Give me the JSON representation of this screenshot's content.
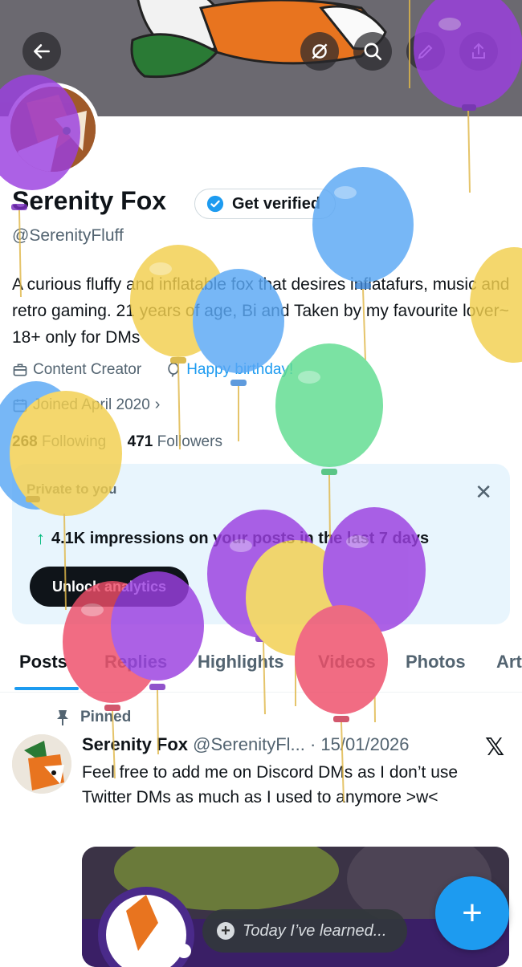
{
  "profile": {
    "name": "Serenity Fox",
    "handle": "@SerenityFluff",
    "verify_label": "Get verified",
    "bio": "A curious fluffy and inflatable fox that desires inflatafurs, music and retro gaming. 21 years of age, Bi and Taken by my favourite lover~ 18+ only for DMs",
    "category": "Content Creator",
    "birthday": "Happy birthday!",
    "joined": "Joined April 2020",
    "following_count": "268",
    "following_label": "Following",
    "followers_count": "471",
    "followers_label": "Followers"
  },
  "header": {
    "back_icon": "arrow-left-icon",
    "icons": [
      "sync-off-icon",
      "search-icon",
      "edit-icon",
      "share-icon"
    ]
  },
  "analytics": {
    "private_label": "Private to you",
    "impressions_text": "4.1K impressions on your posts in the last 7 days",
    "unlock_label": "Unlock analytics"
  },
  "tabs": [
    "Posts",
    "Replies",
    "Highlights",
    "Videos",
    "Photos",
    "Art"
  ],
  "post": {
    "pinned_label": "Pinned",
    "author": "Serenity Fox",
    "handle_date": "@SerenityFl... · 15/01/2026",
    "text": "Feel free to add me on Discord DMs as I don’t use Twitter DMs as much as I used to anymore >w<"
  },
  "composer": {
    "placeholder": "Today I’ve learned..."
  },
  "colors": {
    "accent": "#1d9bf0",
    "banner": "#6b6970",
    "balloon_purple": "#9b3fe0",
    "balloon_blue": "#5aa8f5",
    "balloon_yellow": "#f2cf4e",
    "balloon_green": "#5fdc8f",
    "balloon_red": "#ee4d68"
  }
}
